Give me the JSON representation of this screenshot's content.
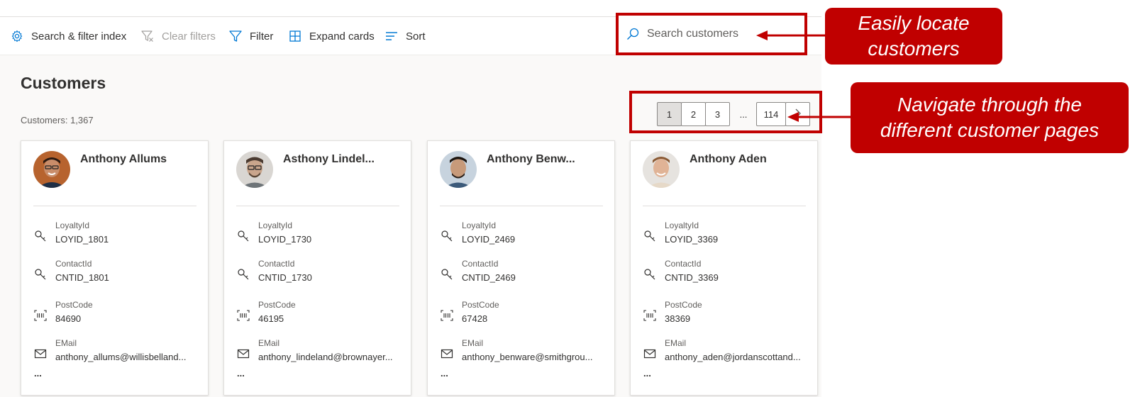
{
  "toolbar": {
    "search_filter_label": "Search & filter index",
    "clear_filters_label": "Clear filters",
    "filter_label": "Filter",
    "expand_cards_label": "Expand cards",
    "sort_label": "Sort"
  },
  "search": {
    "placeholder": "Search customers"
  },
  "page": {
    "title": "Customers",
    "count_text": "Customers: 1,367"
  },
  "pager": {
    "pages": [
      "1",
      "2",
      "3"
    ],
    "ellipsis": "...",
    "last_page": "114",
    "next_icon": "chevron-right-icon"
  },
  "cards": [
    {
      "name": "Anthony Allums",
      "fields": [
        {
          "label": "LoyaltyId",
          "value": "LOYID_1801",
          "icon": "key-icon"
        },
        {
          "label": "ContactId",
          "value": "CNTID_1801",
          "icon": "key-icon"
        },
        {
          "label": "PostCode",
          "value": "84690",
          "icon": "barcode-icon"
        },
        {
          "label": "EMail",
          "value": "anthony_allums@willisbelland...",
          "icon": "mail-icon"
        }
      ],
      "more": "..."
    },
    {
      "name": "Asthony Lindel...",
      "fields": [
        {
          "label": "LoyaltyId",
          "value": "LOYID_1730",
          "icon": "key-icon"
        },
        {
          "label": "ContactId",
          "value": "CNTID_1730",
          "icon": "key-icon"
        },
        {
          "label": "PostCode",
          "value": "46195",
          "icon": "barcode-icon"
        },
        {
          "label": "EMail",
          "value": "anthony_lindeland@brownayer...",
          "icon": "mail-icon"
        }
      ],
      "more": "..."
    },
    {
      "name": "Anthony Benw...",
      "fields": [
        {
          "label": "LoyaltyId",
          "value": "LOYID_2469",
          "icon": "key-icon"
        },
        {
          "label": "ContactId",
          "value": "CNTID_2469",
          "icon": "key-icon"
        },
        {
          "label": "PostCode",
          "value": "67428",
          "icon": "barcode-icon"
        },
        {
          "label": "EMail",
          "value": "anthony_benware@smithgrou...",
          "icon": "mail-icon"
        }
      ],
      "more": "..."
    },
    {
      "name": "Anthony Aden",
      "fields": [
        {
          "label": "LoyaltyId",
          "value": "LOYID_3369",
          "icon": "key-icon"
        },
        {
          "label": "ContactId",
          "value": "CNTID_3369",
          "icon": "key-icon"
        },
        {
          "label": "PostCode",
          "value": "38369",
          "icon": "barcode-icon"
        },
        {
          "label": "EMail",
          "value": "anthony_aden@jordanscottand...",
          "icon": "mail-icon"
        }
      ],
      "more": "..."
    }
  ],
  "callouts": {
    "search_line1": "Easily locate",
    "search_line2": "customers",
    "pager_line1": "Navigate through the",
    "pager_line2": "different customer pages"
  },
  "colors": {
    "accent": "#0078d4",
    "callout": "#c00000",
    "background": "#faf9f8"
  }
}
